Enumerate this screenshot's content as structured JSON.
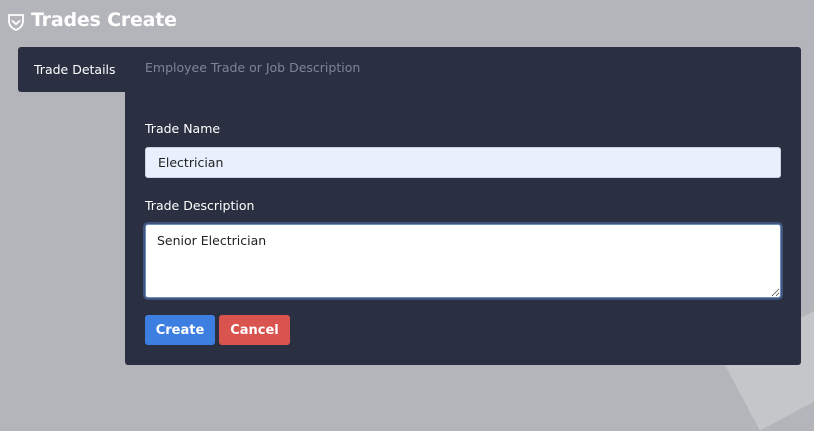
{
  "header": {
    "title": "Trades Create",
    "icon": "shield-check-icon"
  },
  "tabs": [
    {
      "label": "Trade Details",
      "active": true
    }
  ],
  "form": {
    "subtitle": "Employee Trade or Job Description",
    "trade_name": {
      "label": "Trade Name",
      "value": "Electrician"
    },
    "trade_description": {
      "label": "Trade Description",
      "value": "Senior Electrician"
    }
  },
  "actions": {
    "create_label": "Create",
    "cancel_label": "Cancel"
  },
  "colors": {
    "panel_bg": "#2a3042",
    "page_bg": "#b3b5ba",
    "create_button": "#3d7fe0",
    "cancel_button": "#d9534f"
  }
}
